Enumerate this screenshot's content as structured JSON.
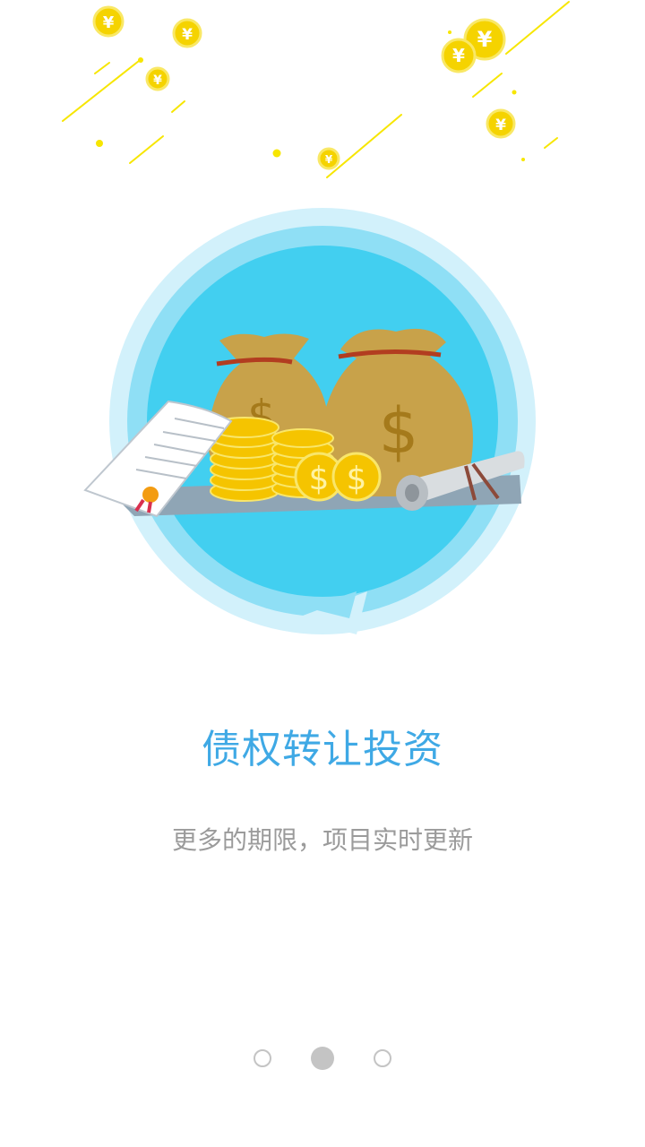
{
  "intro": {
    "title": "债权转让投资",
    "subtitle": "更多的期限，项目实时更新"
  },
  "pager": {
    "total": 3,
    "active_index": 1
  },
  "colors": {
    "title": "#3fa9e5",
    "subtitle": "#9b9b9b",
    "circle_inner": "#42cff0",
    "circle_outer": "#cdf0fa",
    "coin": "#f5d300",
    "bag": "#c8a24a",
    "dot": "#c4c4c4"
  },
  "icons": {
    "coin_symbol": "¥",
    "bag_symbol": "$",
    "stack_coin_symbol": "$"
  }
}
